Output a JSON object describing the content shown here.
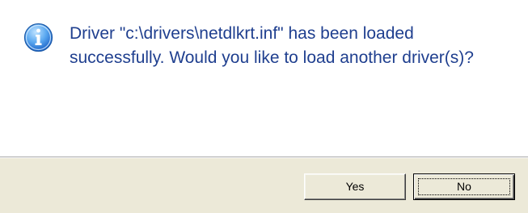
{
  "dialog": {
    "icon": "info-icon",
    "message": "Driver \"c:\\drivers\\netdlkrt.inf\" has been loaded successfully. Would you like to load another driver(s)?"
  },
  "buttons": {
    "yes_label": "Yes",
    "no_label": "No",
    "default_button": "No"
  },
  "colors": {
    "message_text": "#1f3f8f",
    "icon_fill": "#3d8ee8",
    "footer_background": "#ece9d8"
  }
}
